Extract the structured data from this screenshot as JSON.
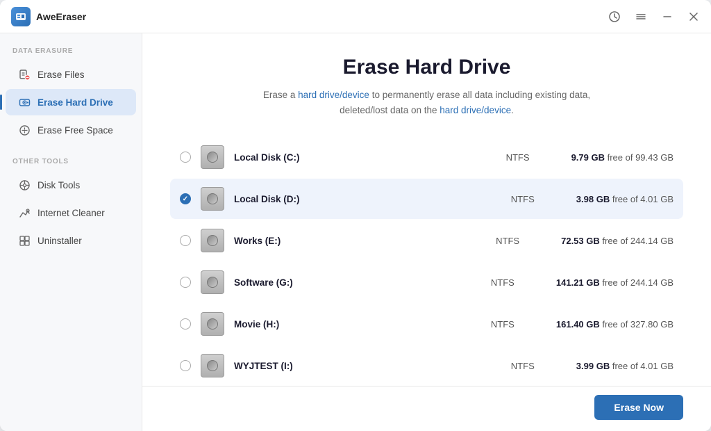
{
  "app": {
    "title": "AweEraser"
  },
  "titlebar": {
    "history_icon": "⏱",
    "menu_icon": "☰",
    "minimize_icon": "—",
    "close_icon": "✕"
  },
  "sidebar": {
    "section_data_erasure": "DATA ERASURE",
    "section_other_tools": "OTHER TOOLS",
    "items": [
      {
        "id": "erase-files",
        "label": "Erase Files",
        "active": false
      },
      {
        "id": "erase-hard-drive",
        "label": "Erase Hard Drive",
        "active": true
      },
      {
        "id": "erase-free-space",
        "label": "Erase Free Space",
        "active": false
      },
      {
        "id": "disk-tools",
        "label": "Disk Tools",
        "active": false
      },
      {
        "id": "internet-cleaner",
        "label": "Internet Cleaner",
        "active": false
      },
      {
        "id": "uninstaller",
        "label": "Uninstaller",
        "active": false
      }
    ]
  },
  "main": {
    "title": "Erase Hard Drive",
    "description_part1": "Erase a ",
    "description_link1": "hard drive/device",
    "description_part2": " to permanently erase all data including existing data,",
    "description_part3": "deleted/lost data on the ",
    "description_link2": "hard drive/device",
    "description_part4": ".",
    "drives": [
      {
        "name": "Local Disk (C:)",
        "fs": "NTFS",
        "free": "9.79 GB",
        "total": "99.43 GB",
        "selected": false
      },
      {
        "name": "Local Disk (D:)",
        "fs": "NTFS",
        "free": "3.98 GB",
        "total": "4.01 GB",
        "selected": true
      },
      {
        "name": "Works (E:)",
        "fs": "NTFS",
        "free": "72.53 GB",
        "total": "244.14 GB",
        "selected": false
      },
      {
        "name": "Software (G:)",
        "fs": "NTFS",
        "free": "141.21 GB",
        "total": "244.14 GB",
        "selected": false
      },
      {
        "name": "Movie (H:)",
        "fs": "NTFS",
        "free": "161.40 GB",
        "total": "327.80 GB",
        "selected": false
      },
      {
        "name": "WYJTEST (I:)",
        "fs": "NTFS",
        "free": "3.99 GB",
        "total": "4.01 GB",
        "selected": false
      }
    ],
    "erase_button": "Erase Now"
  }
}
